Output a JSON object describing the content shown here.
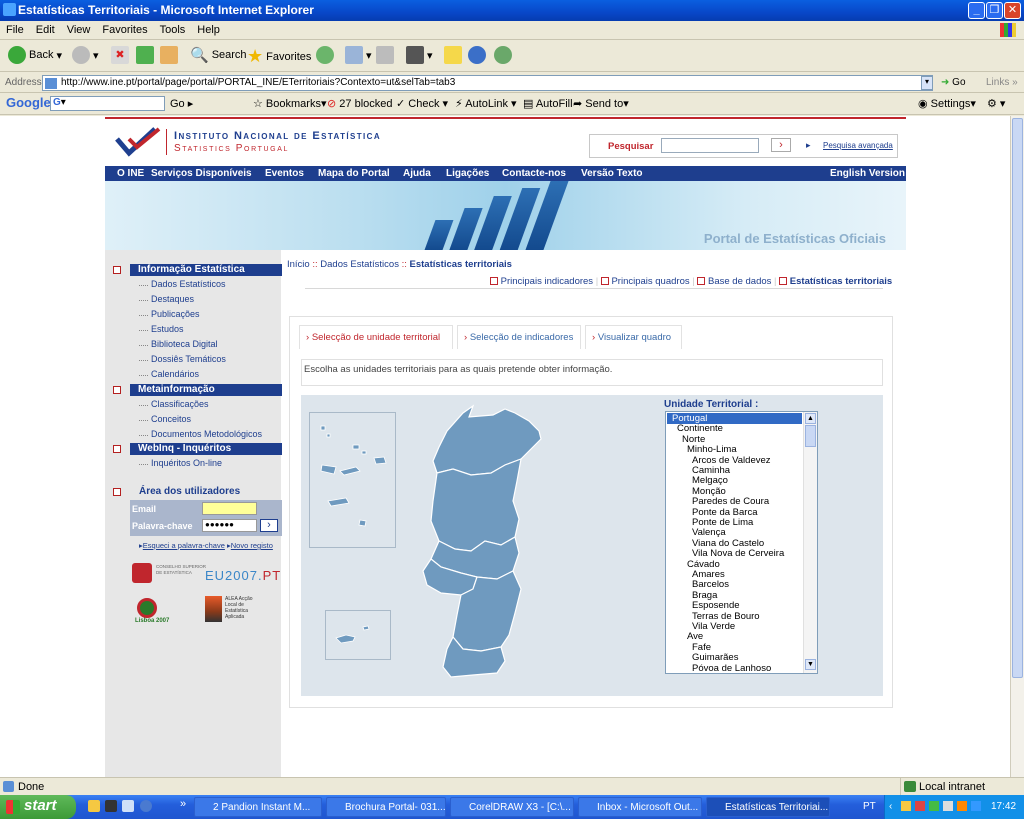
{
  "window": {
    "title": "Estatísticas Territoriais - Microsoft Internet Explorer"
  },
  "menu": [
    "File",
    "Edit",
    "View",
    "Favorites",
    "Tools",
    "Help"
  ],
  "toolbar": {
    "back": "Back",
    "search": "Search",
    "favorites": "Favorites"
  },
  "address": {
    "label": "Address",
    "url": "http://www.ine.pt/portal/page/portal/PORTAL_INE/ETerritoriais?Contexto=ut&selTab=tab3",
    "go": "Go",
    "links": "Links"
  },
  "googlebar": {
    "google": "Google",
    "g": "G",
    "go": "Go",
    "bookmarks": "Bookmarks",
    "blocked": "27 blocked",
    "check": "Check",
    "autolink": "AutoLink",
    "autofill": "AutoFill",
    "sendto": "Send to",
    "settings": "Settings"
  },
  "site": {
    "name_line1": "Instituto Nacional de Estatística",
    "name_line2": "Statistics Portugal",
    "search_label": "Pesquisar",
    "search_go": "›",
    "advanced_search": "Pesquisa avançada",
    "nav": [
      "O INE",
      "Serviços Disponíveis",
      "Eventos",
      "Mapa do Portal",
      "Ajuda",
      "Ligações",
      "Contacte-nos",
      "Versão Texto"
    ],
    "english": "English Version",
    "banner_text": "Portal de Estatísticas Oficiais"
  },
  "sidebar": {
    "sections": [
      {
        "title": "Informação Estatística",
        "items": [
          "Dados Estatísticos",
          "Destaques",
          "Publicações",
          "Estudos",
          "Biblioteca Digital",
          "Dossiês Temáticos",
          "Calendários"
        ]
      },
      {
        "title": "Metainformação",
        "items": [
          "Classificações",
          "Conceitos",
          "Documentos Metodológicos"
        ]
      },
      {
        "title": "WebInq - Inquéritos",
        "items": [
          "Inquéritos On-line"
        ]
      }
    ],
    "user_area": "Área dos utilizadores",
    "email_label": "Email",
    "password_label": "Palavra-chave",
    "password_value": "●●●●●●",
    "forgot": "Esqueci a palavra-chave",
    "register": "Novo registo",
    "logo1_text": "CONSELHO SUPERIOR DE ESTATÍSTICA",
    "eu_logo": "EU2007.",
    "eu_logo_pt": "PT",
    "alea_text": "ALEA Acção Local de Estatística Aplicada",
    "lisboa_text": "Lisboa 2007"
  },
  "content": {
    "breadcrumb_home": "Início",
    "breadcrumb_sep": "::",
    "breadcrumb_dados": "Dados Estatísticos",
    "breadcrumb_current": "Estatísticas territoriais",
    "subtabs": [
      "Principais indicadores",
      "Principais quadros",
      "Base de dados",
      "Estatísticas territoriais"
    ],
    "wizard_tabs": [
      "Selecção de unidade territorial",
      "Selecção de indicadores",
      "Visualizar quadro"
    ],
    "instruction": "Escolha as unidades territoriais para as quais pretende obter informação.",
    "ut_label": "Unidade Territorial :",
    "ut_items": [
      {
        "text": "Portugal",
        "level": 0,
        "selected": true
      },
      {
        "text": "Continente",
        "level": 1
      },
      {
        "text": "Norte",
        "level": 2
      },
      {
        "text": "Minho-Lima",
        "level": 3
      },
      {
        "text": "Arcos de Valdevez",
        "level": 4
      },
      {
        "text": "Caminha",
        "level": 4
      },
      {
        "text": "Melgaço",
        "level": 4
      },
      {
        "text": "Monção",
        "level": 4
      },
      {
        "text": "Paredes de Coura",
        "level": 4
      },
      {
        "text": "Ponte da Barca",
        "level": 4
      },
      {
        "text": "Ponte de Lima",
        "level": 4
      },
      {
        "text": "Valença",
        "level": 4
      },
      {
        "text": "Viana do Castelo",
        "level": 4
      },
      {
        "text": "Vila Nova de Cerveira",
        "level": 4
      },
      {
        "text": "Cávado",
        "level": 3
      },
      {
        "text": "Amares",
        "level": 4
      },
      {
        "text": "Barcelos",
        "level": 4
      },
      {
        "text": "Braga",
        "level": 4
      },
      {
        "text": "Esposende",
        "level": 4
      },
      {
        "text": "Terras de Bouro",
        "level": 4
      },
      {
        "text": "Vila Verde",
        "level": 4
      },
      {
        "text": "Ave",
        "level": 3
      },
      {
        "text": "Fafe",
        "level": 4
      },
      {
        "text": "Guimarães",
        "level": 4
      },
      {
        "text": "Póvoa de Lanhoso",
        "level": 4
      }
    ]
  },
  "statusbar": {
    "status": "Done",
    "zone": "Local intranet"
  },
  "taskbar": {
    "start": "start",
    "tasks": [
      "2 Pandion Instant M...",
      "Brochura Portal- 031...",
      "CorelDRAW X3 - [C:\\...",
      "Inbox - Microsoft Out...",
      "Estatísticas Territoriai..."
    ],
    "lang": "PT",
    "clock": "17:42"
  },
  "colors": {
    "ine_blue": "#1e3e8e",
    "ine_red": "#c0262d",
    "map_fill": "#6f9abf",
    "xp_blue": "#0a5fe0"
  }
}
